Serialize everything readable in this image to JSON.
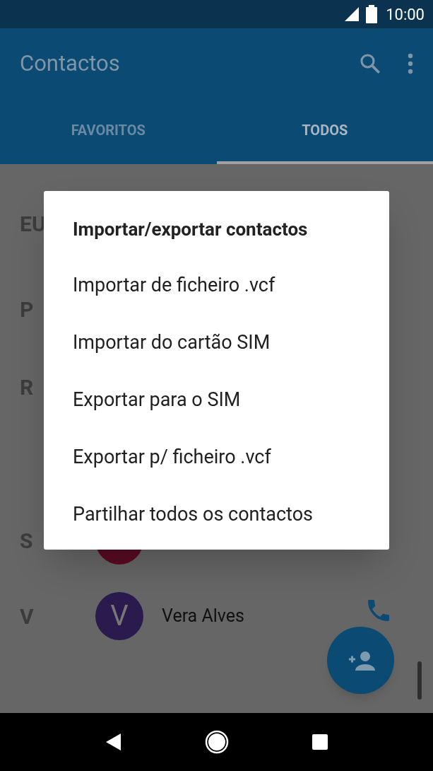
{
  "status_bar": {
    "time": "10:00"
  },
  "app_bar": {
    "title": "Contactos"
  },
  "tabs": [
    {
      "label": "FAVORITOS",
      "selected": false
    },
    {
      "label": "TODOS",
      "selected": true
    }
  ],
  "sections": [
    {
      "letter": "EU"
    },
    {
      "letter": "P"
    },
    {
      "letter": "R"
    },
    {
      "letter": "S",
      "contact": {
        "color": "#5a0b24"
      }
    },
    {
      "letter": "V",
      "contact": {
        "initial": "V",
        "name": "Vera Alves",
        "color": "#2a1a4e"
      }
    }
  ],
  "dialog": {
    "title": "Importar/exportar contactos",
    "items": [
      "Importar de ficheiro .vcf",
      "Importar do cartão SIM",
      "Exportar para o SIM",
      "Exportar p/ ficheiro .vcf",
      "Partilhar todos os contactos"
    ]
  }
}
